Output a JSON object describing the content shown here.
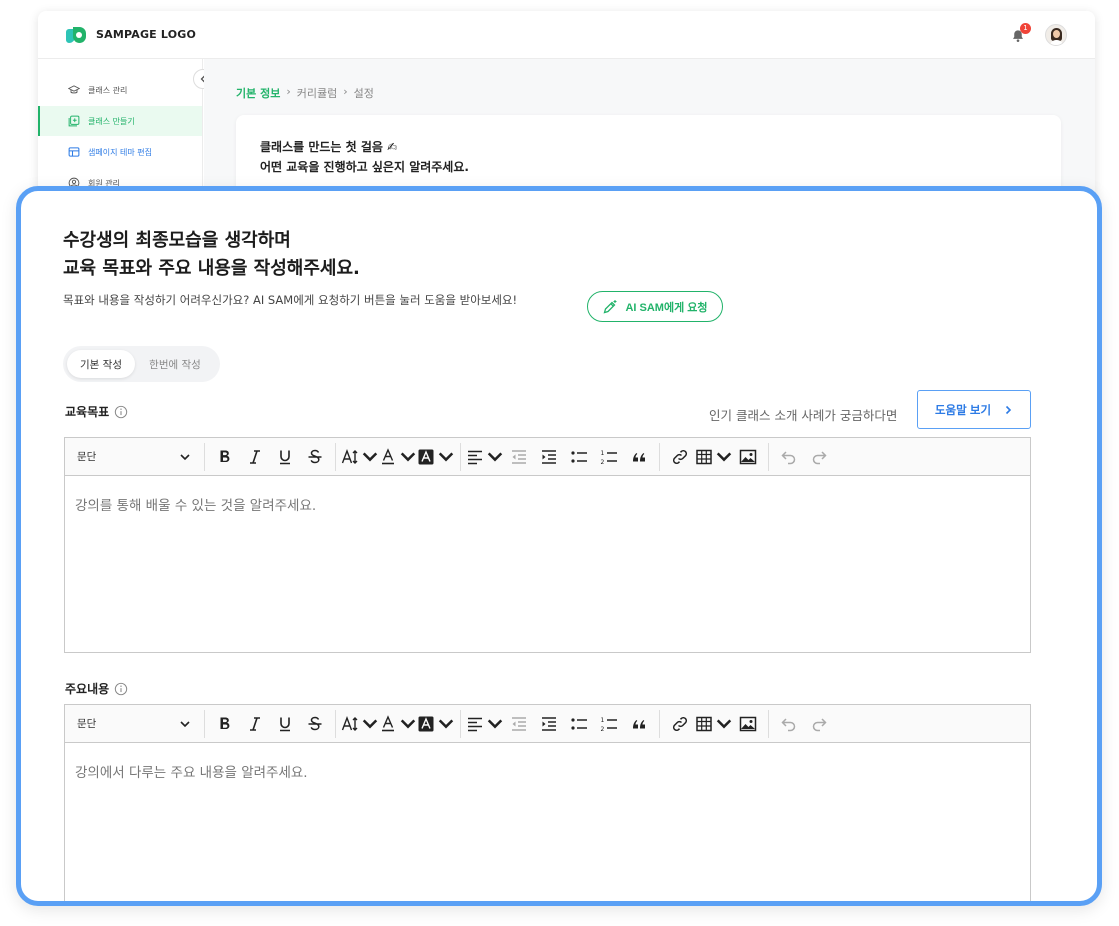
{
  "app": {
    "logo_text": "SAMPAGE LOGO",
    "notification_count": "1",
    "sidebar": {
      "items": [
        {
          "label": "클래스 관리",
          "icon": "graduation-cap-icon"
        },
        {
          "label": "클래스 만들기",
          "icon": "add-square-icon",
          "active": true
        },
        {
          "label": "샘페이지 테마 편집",
          "icon": "layout-icon"
        },
        {
          "label": "회원 관리",
          "icon": "user-circle-icon"
        }
      ]
    },
    "breadcrumb": [
      "기본 정보",
      "커리큘럼",
      "설정"
    ],
    "intro": {
      "line1": "클래스를 만드는 첫 걸음 ✍",
      "line2": "어떤 교육을 진행하고 싶은지 알려주세요."
    }
  },
  "panel": {
    "title_line1": "수강생의 최종모습을 생각하며",
    "title_line2": "교육 목표와 주요 내용을 작성해주세요.",
    "description": "목표와 내용을 작성하기 어려우신가요? AI SAM에게 요청하기 버튼을 눌러 도움을 받아보세요!",
    "ai_button": "AI SAM에게 요청",
    "tabs": [
      "기본 작성",
      "한번에 작성"
    ],
    "goal": {
      "label": "교육목표",
      "hint": "인기 클래스 소개 사례가 궁금하다면",
      "help_button": "도움말 보기",
      "block_style": "문단",
      "placeholder": "강의를 통해 배울 수 있는 것을 알려주세요."
    },
    "content": {
      "label": "주요내용",
      "block_style": "문단",
      "placeholder": "강의에서 다루는 주요 내용을 알려주세요."
    }
  },
  "colors": {
    "accent_green": "#22b36a",
    "accent_blue": "#5aa0f5",
    "link_blue": "#2d7be5"
  }
}
